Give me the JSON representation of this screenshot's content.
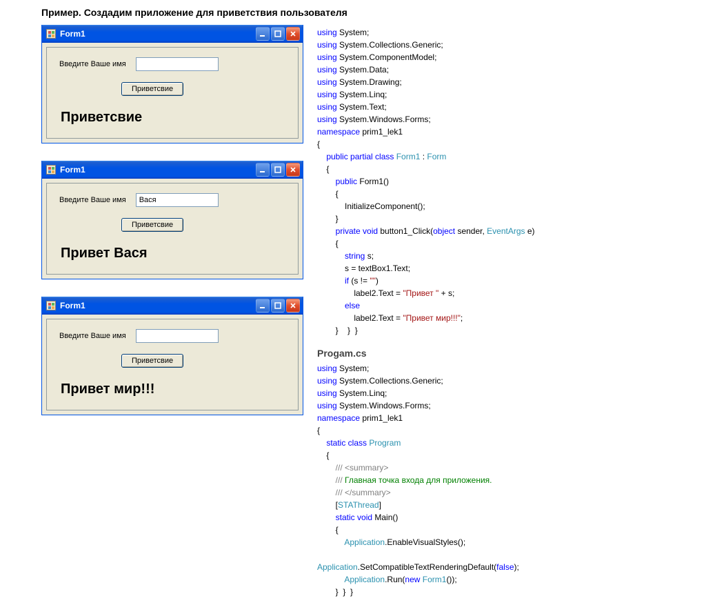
{
  "page_title": "Пример. Создадим приложение для приветствия пользователя",
  "windows": [
    {
      "title": "Form1",
      "label": "Введите Ваше имя",
      "input": "",
      "button": "Приветсвие",
      "result": "Приветсвие"
    },
    {
      "title": "Form1",
      "label": "Введите Ваше имя",
      "input": "Вася",
      "button": "Приветсвие",
      "result": "Привет Вася"
    },
    {
      "title": "Form1",
      "label": "Введите Ваше имя",
      "input": "",
      "button": "Приветсвие",
      "result": "Привет мир!!!"
    }
  ],
  "code1": [
    {
      "t": "using ",
      "c": "kw-blue"
    },
    {
      "t": "System;\n"
    },
    {
      "t": "using ",
      "c": "kw-blue"
    },
    {
      "t": "System.Collections.Generic;\n"
    },
    {
      "t": "using ",
      "c": "kw-blue"
    },
    {
      "t": "System.ComponentModel;\n"
    },
    {
      "t": "using ",
      "c": "kw-blue"
    },
    {
      "t": "System.Data;\n"
    },
    {
      "t": "using ",
      "c": "kw-blue"
    },
    {
      "t": "System.Drawing;\n"
    },
    {
      "t": "using ",
      "c": "kw-blue"
    },
    {
      "t": "System.Linq;\n"
    },
    {
      "t": "using ",
      "c": "kw-blue"
    },
    {
      "t": "System.Text;\n"
    },
    {
      "t": "using ",
      "c": "kw-blue"
    },
    {
      "t": "System.Windows.Forms;\n"
    },
    {
      "t": "namespace ",
      "c": "kw-blue"
    },
    {
      "t": "prim1_lek1\n"
    },
    {
      "t": "{\n"
    },
    {
      "t": "    public partial class ",
      "c": "kw-blue"
    },
    {
      "t": "Form1",
      "c": "kw-teal"
    },
    {
      "t": " : "
    },
    {
      "t": "Form",
      "c": "kw-teal"
    },
    {
      "t": "\n"
    },
    {
      "t": "    {\n"
    },
    {
      "t": "        public ",
      "c": "kw-blue"
    },
    {
      "t": "Form1()\n"
    },
    {
      "t": "        {\n"
    },
    {
      "t": "            InitializeComponent();\n"
    },
    {
      "t": "        }\n"
    },
    {
      "t": "        private void ",
      "c": "kw-blue"
    },
    {
      "t": "button1_Click("
    },
    {
      "t": "object ",
      "c": "kw-blue"
    },
    {
      "t": "sender, "
    },
    {
      "t": "EventArgs",
      "c": "kw-teal"
    },
    {
      "t": " e)\n"
    },
    {
      "t": "        {\n"
    },
    {
      "t": "            string ",
      "c": "kw-blue"
    },
    {
      "t": "s;\n"
    },
    {
      "t": "            s = textBox1.Text;\n"
    },
    {
      "t": "            if ",
      "c": "kw-blue"
    },
    {
      "t": "(s != "
    },
    {
      "t": "\"\"",
      "c": "kw-str"
    },
    {
      "t": ")\n"
    },
    {
      "t": "                label2.Text = "
    },
    {
      "t": "\"Привет \"",
      "c": "kw-str"
    },
    {
      "t": " + s;\n"
    },
    {
      "t": "            else",
      "c": "kw-blue"
    },
    {
      "t": "\n"
    },
    {
      "t": "                label2.Text = "
    },
    {
      "t": "\"Привет мир!!!\"",
      "c": "kw-str"
    },
    {
      "t": ";\n"
    },
    {
      "t": "        }    }  }\n"
    }
  ],
  "filename2": "Progam.cs",
  "code2": [
    {
      "t": "using ",
      "c": "kw-blue"
    },
    {
      "t": "System;\n"
    },
    {
      "t": "using ",
      "c": "kw-blue"
    },
    {
      "t": "System.Collections.Generic;\n"
    },
    {
      "t": "using ",
      "c": "kw-blue"
    },
    {
      "t": "System.Linq;\n"
    },
    {
      "t": "using ",
      "c": "kw-blue"
    },
    {
      "t": "System.Windows.Forms;\n"
    },
    {
      "t": "namespace ",
      "c": "kw-blue"
    },
    {
      "t": "prim1_lek1\n"
    },
    {
      "t": "{\n"
    },
    {
      "t": "    static class ",
      "c": "kw-blue"
    },
    {
      "t": "Program",
      "c": "kw-teal"
    },
    {
      "t": "\n"
    },
    {
      "t": "    {\n"
    },
    {
      "t": "        /// <summary>",
      "c": "kw-gray"
    },
    {
      "t": "\n"
    },
    {
      "t": "        /// ",
      "c": "kw-gray"
    },
    {
      "t": "Главная точка входа для приложения.",
      "c": "kw-green"
    },
    {
      "t": "\n"
    },
    {
      "t": "        /// </summary>",
      "c": "kw-gray"
    },
    {
      "t": "\n"
    },
    {
      "t": "        ["
    },
    {
      "t": "STAThread",
      "c": "kw-teal"
    },
    {
      "t": "]\n"
    },
    {
      "t": "        static void ",
      "c": "kw-blue"
    },
    {
      "t": "Main()\n"
    },
    {
      "t": "        {\n"
    },
    {
      "t": "            Application",
      "c": "kw-teal"
    },
    {
      "t": ".EnableVisualStyles();\n"
    },
    {
      "t": "\n"
    },
    {
      "t": "Application",
      "c": "kw-teal"
    },
    {
      "t": ".SetCompatibleTextRenderingDefault("
    },
    {
      "t": "false",
      "c": "kw-blue"
    },
    {
      "t": ");\n"
    },
    {
      "t": "            Application",
      "c": "kw-teal"
    },
    {
      "t": ".Run("
    },
    {
      "t": "new ",
      "c": "kw-blue"
    },
    {
      "t": "Form1",
      "c": "kw-teal"
    },
    {
      "t": "());\n"
    },
    {
      "t": "        }  }  }\n"
    }
  ]
}
